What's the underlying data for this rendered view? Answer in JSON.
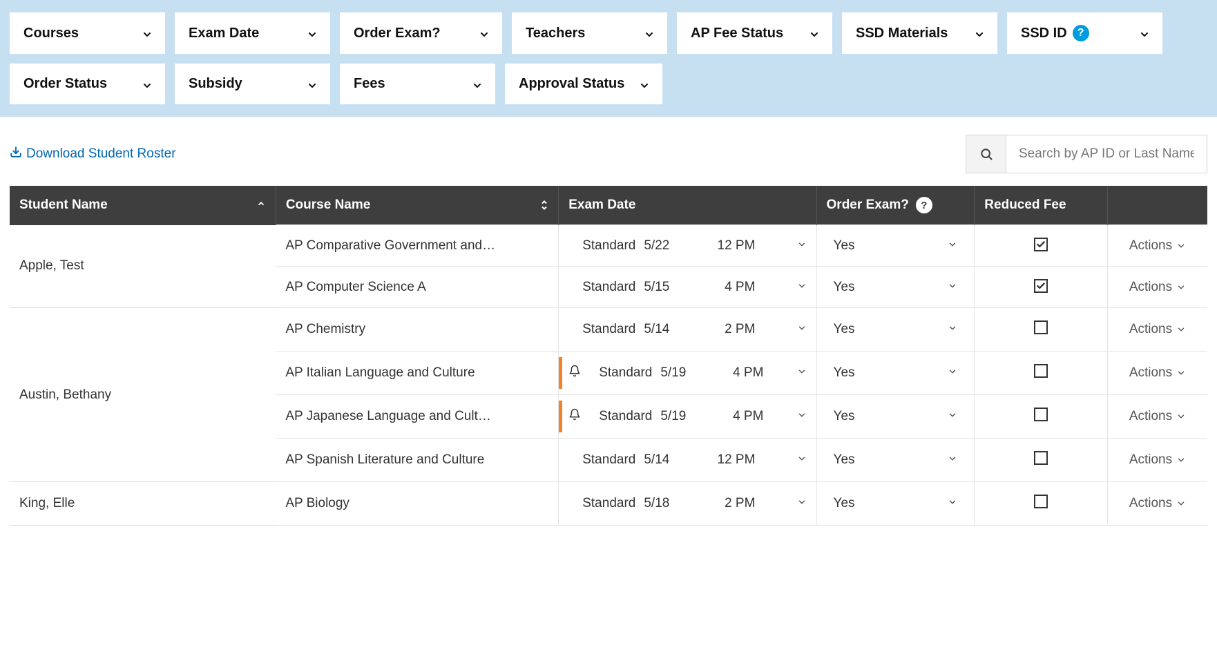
{
  "filters": [
    {
      "label": "Courses",
      "help": false
    },
    {
      "label": "Exam Date",
      "help": false
    },
    {
      "label": "Order Exam?",
      "help": false
    },
    {
      "label": "Teachers",
      "help": false
    },
    {
      "label": "AP Fee Status",
      "help": false
    },
    {
      "label": "SSD Materials",
      "help": false
    },
    {
      "label": "SSD ID",
      "help": true
    },
    {
      "label": "Order Status",
      "help": false
    },
    {
      "label": "Subsidy",
      "help": false
    },
    {
      "label": "Fees",
      "help": false
    },
    {
      "label": "Approval Status",
      "help": false
    }
  ],
  "download_label": "Download Student Roster",
  "search": {
    "placeholder": "Search by AP ID or Last Name"
  },
  "columns": {
    "student": "Student Name",
    "course": "Course Name",
    "exam": "Exam Date",
    "order": "Order Exam?",
    "fee": "Reduced Fee"
  },
  "actions_label": "Actions",
  "rows": [
    {
      "student": "Apple, Test",
      "rowspan": 2,
      "course": "AP Comparative Government and…",
      "alert": false,
      "type": "Standard",
      "date": "5/22",
      "time": "12 PM",
      "order": "Yes",
      "fee": true
    },
    {
      "student": "",
      "course": "AP Computer Science A",
      "alert": false,
      "type": "Standard",
      "date": "5/15",
      "time": "4 PM",
      "order": "Yes",
      "fee": true
    },
    {
      "student": "Austin, Bethany",
      "rowspan": 4,
      "course": "AP Chemistry",
      "alert": false,
      "type": "Standard",
      "date": "5/14",
      "time": "2 PM",
      "order": "Yes",
      "fee": false
    },
    {
      "student": "",
      "course": "AP Italian Language and Culture",
      "alert": true,
      "type": "Standard",
      "date": "5/19",
      "time": "4 PM",
      "order": "Yes",
      "fee": false
    },
    {
      "student": "",
      "course": "AP Japanese Language and Cult…",
      "alert": true,
      "type": "Standard",
      "date": "5/19",
      "time": "4 PM",
      "order": "Yes",
      "fee": false
    },
    {
      "student": "",
      "course": "AP Spanish Literature and Culture",
      "alert": false,
      "type": "Standard",
      "date": "5/14",
      "time": "12 PM",
      "order": "Yes",
      "fee": false
    },
    {
      "student": "King, Elle",
      "rowspan": 1,
      "course": "AP Biology",
      "alert": false,
      "type": "Standard",
      "date": "5/18",
      "time": "2 PM",
      "order": "Yes",
      "fee": false
    }
  ]
}
